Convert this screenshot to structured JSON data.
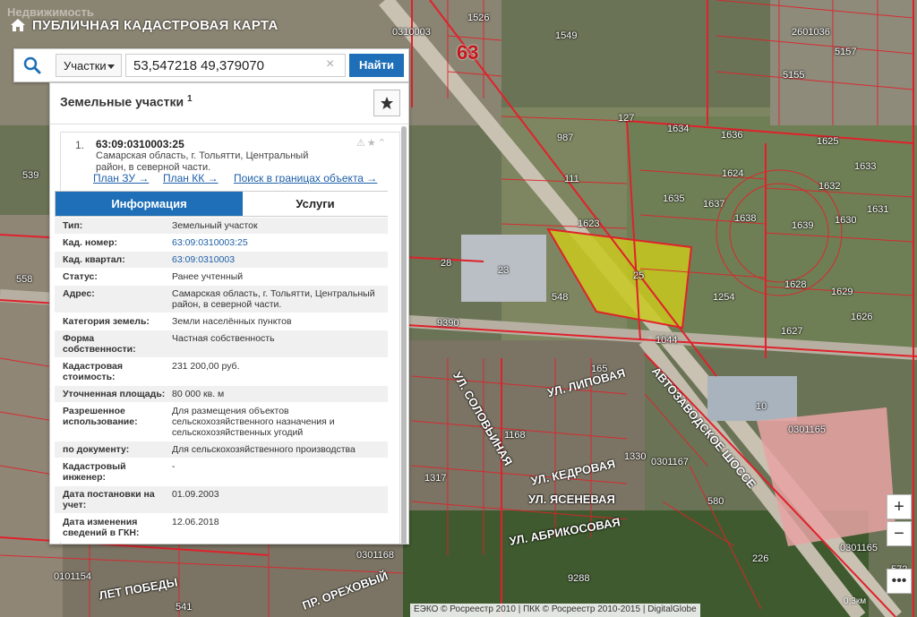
{
  "header": {
    "watermark": "Недвижимость",
    "title": "ПУБЛИЧНАЯ КАДАСТРОВАЯ КАРТА"
  },
  "search": {
    "type_label": "Участки",
    "query": "53,547218 49,379070",
    "button_label": "Найти"
  },
  "panel": {
    "title": "Земельные участки",
    "count": "1",
    "result": {
      "index": "1.",
      "cad_number": "63:09:0310003:25",
      "address": "Самарская область, г. Тольятти, Центральный район, в северной части."
    },
    "links": [
      "План ЗУ →",
      "План КК →",
      "Поиск в границах объекта →"
    ],
    "tabs": [
      "Информация",
      "Услуги"
    ],
    "attributes": [
      {
        "key": "Тип:",
        "value": "Земельный участок"
      },
      {
        "key": "Кад. номер:",
        "value": "63:09:0310003:25"
      },
      {
        "key": "Кад. квартал:",
        "value": "63:09:0310003"
      },
      {
        "key": "Статус:",
        "value": "Ранее учтенный"
      },
      {
        "key": "Адрес:",
        "value": "Самарская область, г. Тольятти, Центральный район, в северной части."
      },
      {
        "key": "Категория земель:",
        "value": "Земли населённых пунктов"
      },
      {
        "key": "Форма собственности:",
        "value": "Частная собственность"
      },
      {
        "key": "Кадастровая стоимость:",
        "value": "231 200,00 руб."
      },
      {
        "key": "Уточненная площадь:",
        "value": "80 000 кв. м"
      },
      {
        "key": "Разрешенное использование:",
        "value": "Для размещения объектов сельскохозяйственного назначения и сельскохозяйственных угодий"
      },
      {
        "key": "по документу:",
        "value": "Для сельскохозяйственного производства"
      },
      {
        "key": "Кадастровый инженер:",
        "value": "-"
      },
      {
        "key": "Дата постановки на учет:",
        "value": "01.09.2003"
      },
      {
        "key": "Дата изменения сведений в ГКН:",
        "value": "12.06.2018"
      }
    ]
  },
  "map": {
    "district_number": "63",
    "highlighted_parcel": "25",
    "parcel_labels": [
      "1526",
      "0310003",
      "1549",
      "127",
      "987",
      "1634",
      "1636",
      "1625",
      "1633",
      "111",
      "1624",
      "1632",
      "1635",
      "1637",
      "1638",
      "1639",
      "1630",
      "1631",
      "1623",
      "28",
      "23",
      "1254",
      "1628",
      "1629",
      "1626",
      "1627",
      "548",
      "9390",
      "1044",
      "165",
      "10",
      "0301165",
      "1168",
      "1330",
      "0301167",
      "1317",
      "580",
      "226",
      "9288",
      "0301168",
      "0101154",
      "541",
      "539",
      "558",
      "572",
      "0301165",
      "2601036",
      "5157",
      "5155",
      "1628"
    ],
    "street_labels": [
      "УЛ. ЛИПОВАЯ",
      "УЛ. СОЛОВЬИНАЯ",
      "УЛ. КЕДРОВАЯ",
      "УЛ. ЯСЕНЕВАЯ",
      "УЛ. АБРИКОСОВАЯ",
      "АВТОЗАВОДСКОЕ ШОССЕ",
      "ПР. ОРЕХОВЫЙ",
      "ЛЕТ ПОБЕДЫ"
    ],
    "attribution": "ЕЭКО © Росреестр 2010 | ПКК © Росреестр 2010-2015 | DigitalGlobe",
    "scale": "0,3км"
  },
  "colors": {
    "accent": "#1e6fb8",
    "boundary": "#e0212b",
    "highlight": "#c8c81e"
  }
}
